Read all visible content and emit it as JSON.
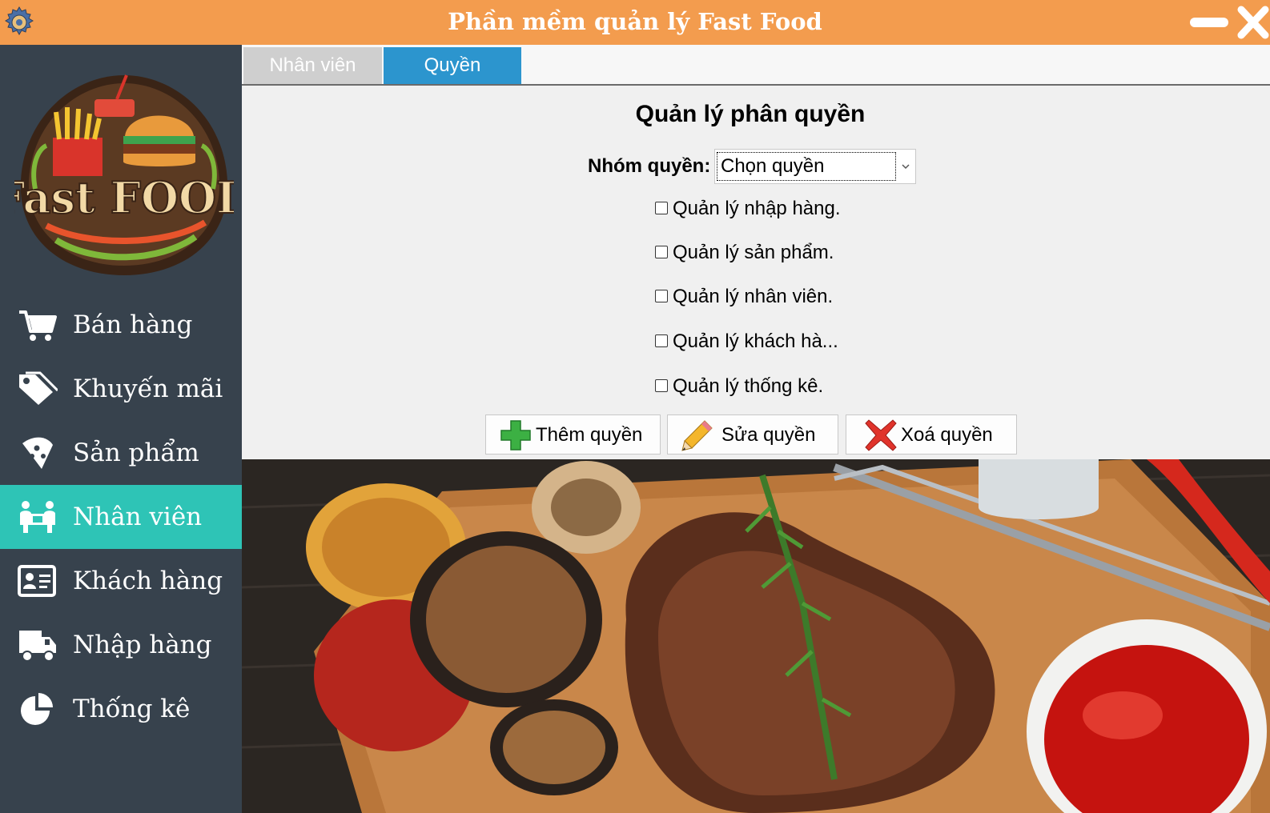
{
  "window": {
    "title": "Phần mềm quản lý Fast Food",
    "icons": {
      "app": "gear-icon",
      "minimize": "minimize-icon",
      "close": "close-icon"
    }
  },
  "sidebar": {
    "logo_text": "FastFOOD",
    "items": [
      {
        "label": "Bán hàng",
        "icon": "cart-icon",
        "active": false
      },
      {
        "label": "Khuyến mãi",
        "icon": "tag-icon",
        "active": false
      },
      {
        "label": "Sản phẩm",
        "icon": "pizza-icon",
        "active": false
      },
      {
        "label": "Nhân viên",
        "icon": "staff-icon",
        "active": true
      },
      {
        "label": "Khách hàng",
        "icon": "id-card-icon",
        "active": false
      },
      {
        "label": "Nhập hàng",
        "icon": "truck-icon",
        "active": false
      },
      {
        "label": "Thống kê",
        "icon": "pie-chart-icon",
        "active": false
      }
    ],
    "colors": {
      "background": "#37424d",
      "active": "#2ec4b6"
    }
  },
  "tabs": [
    {
      "label": "Nhân viên",
      "selected": false
    },
    {
      "label": "Quyền",
      "selected": true
    }
  ],
  "permissions": {
    "title": "Quản lý phân quyền",
    "group_label": "Nhóm quyền:",
    "group_selected": "Chọn quyền",
    "checkboxes": [
      {
        "label": "Quản lý nhập hàng.",
        "checked": false
      },
      {
        "label": "Quản lý sản phẩm.",
        "checked": false
      },
      {
        "label": "Quản lý nhân viên.",
        "checked": false
      },
      {
        "label": "Quản lý khách hà...",
        "checked": false
      },
      {
        "label": "Quản lý thống kê.",
        "checked": false
      }
    ],
    "buttons": {
      "add": "Thêm quyền",
      "edit": "Sửa quyền",
      "delete": "Xoá quyền"
    }
  },
  "theme": {
    "titlebar": "#f39c4e",
    "tab_selected": "#2c95ce",
    "tab_unselected": "#cfcfcf"
  }
}
